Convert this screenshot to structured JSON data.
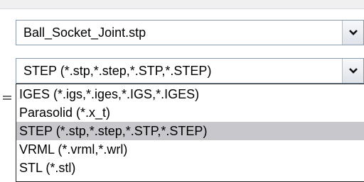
{
  "file_combo": {
    "value": "Ball_Socket_Joint.stp"
  },
  "type_combo": {
    "value": "STEP (*.stp,*.step,*.STP,*.STEP)"
  },
  "dropdown": {
    "options": [
      "IGES (*.igs,*.iges,*.IGS,*.IGES)",
      "Parasolid (*.x_t)",
      "STEP (*.stp,*.step,*.STP,*.STEP)",
      "VRML (*.vrml,*.wrl)",
      "STL (*.stl)"
    ],
    "selected": "STEP (*.stp,*.step,*.STP,*.STEP)"
  },
  "icons": {
    "combo_arrow": "chevron-down-icon"
  },
  "colors": {
    "selection": "#c7c7cc",
    "combo_border": "#8a9aae"
  }
}
